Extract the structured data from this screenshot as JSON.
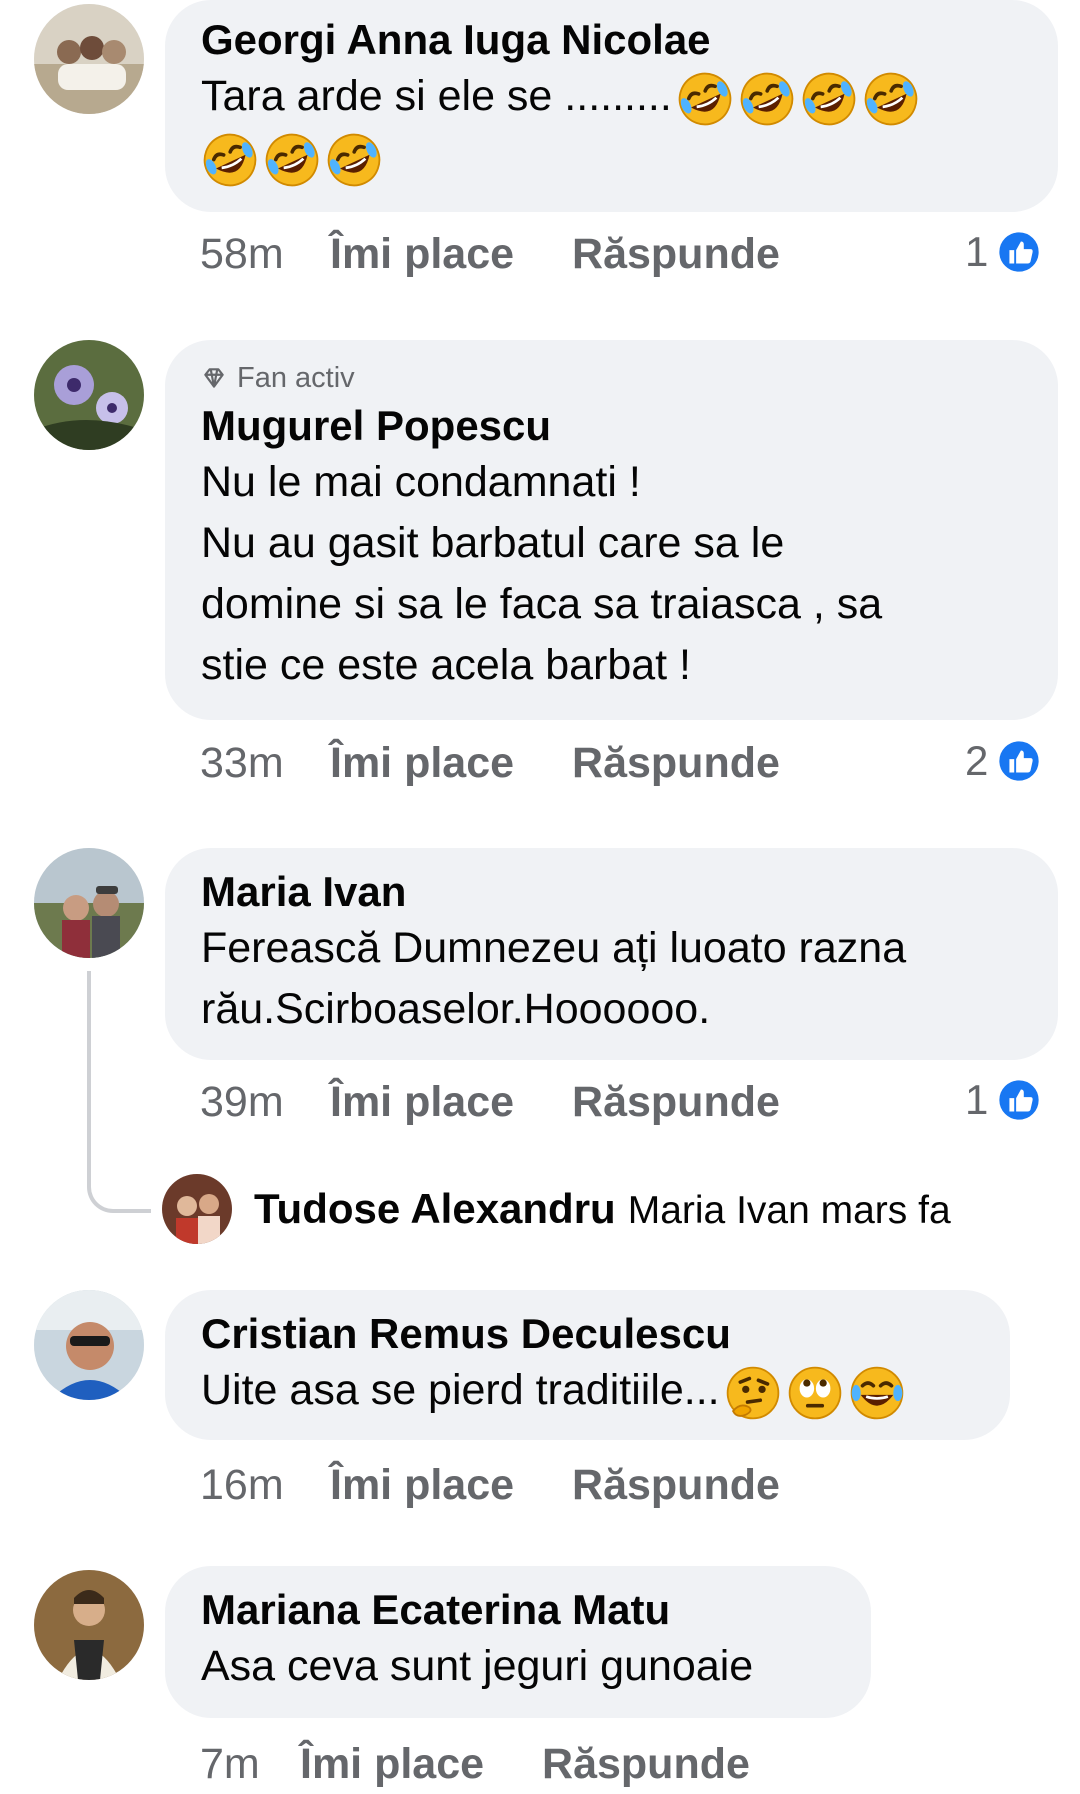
{
  "comments": [
    {
      "author": "Georgi Anna Iuga Nicolae",
      "text": "Tara arde si ele se .........",
      "emojis": [
        "rofl-emoji",
        "rofl-emoji",
        "rofl-emoji",
        "rofl-emoji",
        "rofl-emoji",
        "rofl-emoji",
        "rofl-emoji"
      ],
      "time": "58m",
      "like_label": "Îmi place",
      "reply_label": "Răspunde",
      "like_count": "1"
    },
    {
      "badge": "Fan activ",
      "author": "Mugurel Popescu",
      "text_lines": [
        "Nu le mai condamnati !",
        "Nu au gasit barbatul care sa le",
        "domine si sa le faca sa traiasca , sa",
        "stie ce este acela barbat !"
      ],
      "time": "33m",
      "like_label": "Îmi place",
      "reply_label": "Răspunde",
      "like_count": "2"
    },
    {
      "author": "Maria Ivan",
      "text_lines": [
        "Ferească Dumnezeu ați luoato razna",
        "rău.Scirboaselor.Hoooooo."
      ],
      "time": "39m",
      "like_label": "Îmi place",
      "reply_label": "Răspunde",
      "like_count": "1",
      "reply": {
        "author": "Tudose Alexandru",
        "text": "Maria Ivan mars fa"
      }
    },
    {
      "author": "Cristian Remus Deculescu",
      "text": "Uite asa se pierd traditiile...",
      "emojis": [
        "thinking-emoji",
        "eye-roll-emoji",
        "laughing-tears-emoji"
      ],
      "time": "16m",
      "like_label": "Îmi place",
      "reply_label": "Răspunde"
    },
    {
      "author": "Mariana Ecaterina Matu",
      "text": "Asa ceva sunt jeguri gunoaie",
      "time": "7m",
      "like_label": "Îmi place",
      "reply_label": "Răspunde"
    }
  ],
  "colors": {
    "bubble": "#f0f2f5",
    "meta_text": "#65676b",
    "like_blue": "#1877f2"
  }
}
